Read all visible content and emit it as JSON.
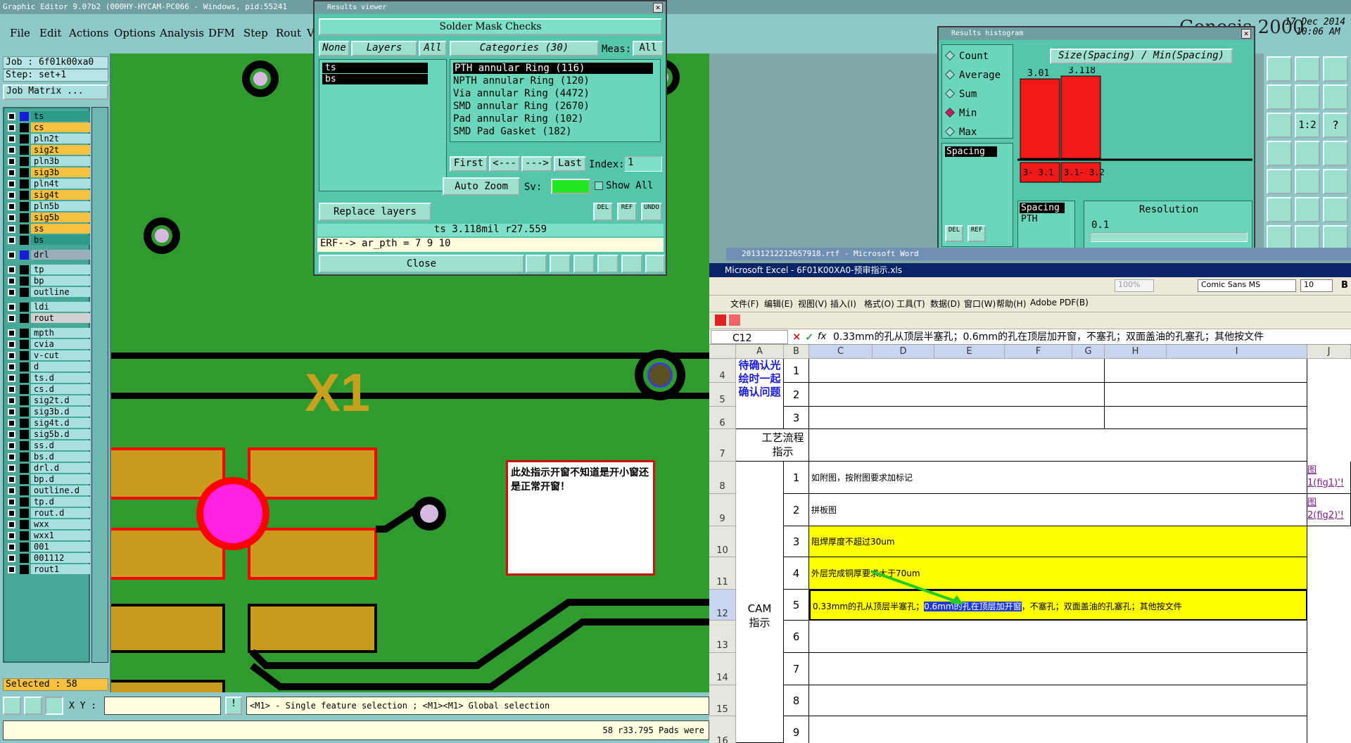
{
  "app": {
    "title": "Graphic Editor 9.0?b2  (000HY-HYCAM-PC066 - Windows, pid:55241",
    "brand": "Genesis 2000",
    "date": "17 Dec 2014",
    "time": "10:06 AM"
  },
  "menu": [
    "File",
    "Edit",
    "Actions",
    "Options",
    "Analysis",
    "DFM",
    "Step",
    "Rout",
    "V"
  ],
  "job": {
    "job": "Job : 6f01k00xa0",
    "step": "Step: set+1",
    "matrix": "Job Matrix ..."
  },
  "layers": [
    {
      "n": "ts",
      "c": "#2e9b8a",
      "sel": true
    },
    {
      "n": "cs",
      "c": "#f6c040"
    },
    {
      "n": "pln2t",
      "c": "#a8e0e0"
    },
    {
      "n": "sig2t",
      "c": "#f6c040"
    },
    {
      "n": "pln3b",
      "c": "#a8e0e0"
    },
    {
      "n": "sig3b",
      "c": "#f6c040"
    },
    {
      "n": "pln4t",
      "c": "#a8e0e0"
    },
    {
      "n": "sig4t",
      "c": "#f6c040"
    },
    {
      "n": "pln5b",
      "c": "#a8e0e0"
    },
    {
      "n": "sig5b",
      "c": "#f6c040"
    },
    {
      "n": "ss",
      "c": "#f6c040"
    },
    {
      "n": "bs",
      "c": "#2e9b8a"
    },
    {
      "n": "drl",
      "c": "#9ab0b8"
    },
    {
      "n": "tp",
      "c": "#a8e0e0"
    },
    {
      "n": "bp",
      "c": "#a8e0e0"
    },
    {
      "n": "outline",
      "c": "#a8e0e0"
    },
    {
      "n": "ldi",
      "c": "#a8e0e0"
    },
    {
      "n": "rout",
      "c": "#d0d0d0"
    },
    {
      "n": "mpth",
      "c": "#a8e0e0"
    },
    {
      "n": "cvia",
      "c": "#a8e0e0"
    },
    {
      "n": "v-cut",
      "c": "#a8e0e0"
    },
    {
      "n": "d",
      "c": "#a8e0e0"
    },
    {
      "n": "ts.d",
      "c": "#a8e0e0"
    },
    {
      "n": "cs.d",
      "c": "#a8e0e0"
    },
    {
      "n": "sig2t.d",
      "c": "#a8e0e0"
    },
    {
      "n": "sig3b.d",
      "c": "#a8e0e0"
    },
    {
      "n": "sig4t.d",
      "c": "#a8e0e0"
    },
    {
      "n": "sig5b.d",
      "c": "#a8e0e0"
    },
    {
      "n": "ss.d",
      "c": "#a8e0e0"
    },
    {
      "n": "bs.d",
      "c": "#a8e0e0"
    },
    {
      "n": "drl.d",
      "c": "#a8e0e0"
    },
    {
      "n": "bp.d",
      "c": "#a8e0e0"
    },
    {
      "n": "outline.d",
      "c": "#a8e0e0"
    },
    {
      "n": "tp.d",
      "c": "#a8e0e0"
    },
    {
      "n": "rout.d",
      "c": "#a8e0e0"
    },
    {
      "n": "wxx",
      "c": "#a8e0e0"
    },
    {
      "n": "wxx1",
      "c": "#a8e0e0"
    },
    {
      "n": "001",
      "c": "#a8e0e0"
    },
    {
      "n": "001112",
      "c": "#a8e0e0"
    },
    {
      "n": "rout1",
      "c": "#a8e0e0"
    }
  ],
  "selected": "Selected : 58",
  "board": {
    "label": "X1",
    "note": "此处指示开窗不知道是开小窗还是正常开窗！"
  },
  "bottom": {
    "xy_label": "X Y :",
    "hint": "<M1> - Single feature selection ; <M1><M1> Global selection",
    "status": "58 r33.795 Pads were"
  },
  "results": {
    "title": "Results viewer",
    "header": "Solder Mask Checks",
    "none": "None",
    "layers_label": "Layers",
    "all": "All",
    "layer_items": [
      "ts",
      "bs"
    ],
    "categories": "Categories (30)",
    "meas": "Meas:",
    "meas_val": "All",
    "cats": [
      "PTH annular Ring (116)",
      "NPTH annular Ring (120)",
      "Via annular Ring (4472)",
      "SMD annular Ring (2670)",
      "Pad annular Ring (102)",
      "SMD Pad Gasket (182)"
    ],
    "first": "First",
    "prev": "<---",
    "next": "--->",
    "last": "Last",
    "index_label": "Index:",
    "index_val": "1",
    "autozoom": "Auto Zoom",
    "sv": "Sv:",
    "showall": "Show All",
    "replace": "Replace layers",
    "btn1": "DEL",
    "btn2": "REF",
    "btn3": "UNDO",
    "status": "ts 3.118mil  r27.559",
    "erf": "ERF--> ar_pth = 7 9 10",
    "close": "Close"
  },
  "hist": {
    "title": "Results histogram",
    "heading": "Size(Spacing) / Min(Spacing)",
    "opts": [
      "Count",
      "Average",
      "Sum",
      "Min",
      "Max"
    ],
    "selected_opt": "Min",
    "bars": [
      {
        "label": "3.01",
        "value": 3.01,
        "range": "3- 3.1"
      },
      {
        "label": "3.118",
        "value": 3.118,
        "range": "3.1- 3.2"
      }
    ],
    "list1": [
      "Spacing"
    ],
    "list2": [
      "Spacing",
      "PTH"
    ],
    "resolution": "Resolution",
    "res_val": "0.1",
    "b1": "DEL",
    "b2": "REF"
  },
  "word_title": "20131212212657918.rtf - Microsoft Word",
  "excel": {
    "title": "Microsoft Excel - 6F01K00XA0-预审指示.xls",
    "font": "Comic Sans MS",
    "size": "10",
    "zoom": "100%",
    "menu": [
      "文件(F)",
      "编辑(E)",
      "视图(V)",
      "插入(I)",
      "格式(O)",
      "工具(T)",
      "数据(D)",
      "窗口(W)",
      "帮助(H)",
      "Adobe PDF(B)"
    ],
    "cellref": "C12",
    "formula": "0.33mm的孔从顶层半塞孔；0.6mm的孔在顶层加开窗，不塞孔；双面盖油的孔塞孔；其他按文件",
    "cols": [
      "A",
      "B",
      "C",
      "D",
      "E",
      "F",
      "G",
      "H",
      "I",
      "J"
    ],
    "rows": [
      "4",
      "5",
      "6",
      "7",
      "8",
      "9",
      "10",
      "11",
      "12",
      "13",
      "14",
      "15",
      "16"
    ],
    "confirm": "待确认光绘时一起确认问题",
    "process": "工艺流程指示",
    "cam": "CAM指示",
    "nums": [
      "1",
      "2",
      "3",
      "1",
      "2",
      "3",
      "4",
      "5",
      "6",
      "7",
      "8",
      "9"
    ],
    "c8": "如附图，按附图要求加标记",
    "c9": "拼板图",
    "c10": "阻焊厚度不超过30um",
    "c11": "外层完成铜厚要求大于70um",
    "c12a": "0.33mm的孔从顶层半塞孔；",
    "c12b": "0.6mm的孔在顶层加开窗",
    "c12c": "，不塞孔；双面盖油的孔塞孔；其他按文件",
    "link1": "图1(fig1)'!",
    "link2": "图2(fig2)'!"
  }
}
